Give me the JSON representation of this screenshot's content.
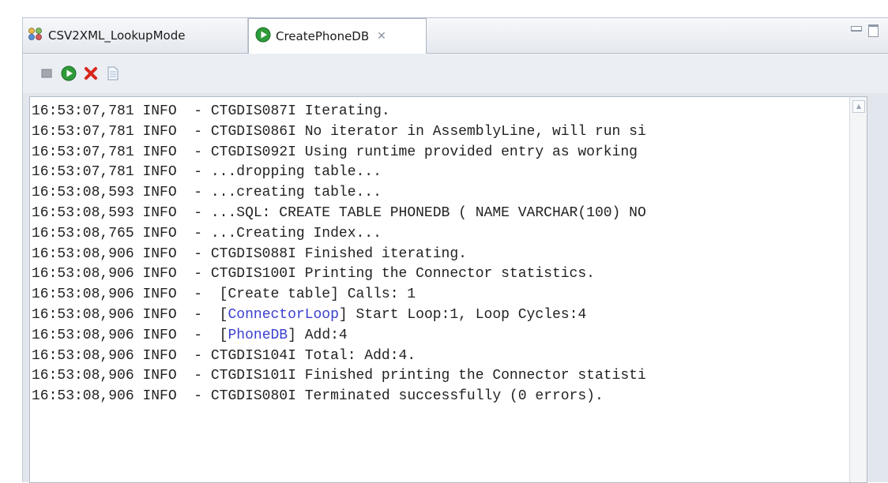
{
  "tabs": [
    {
      "label": "CSV2XML_LookupMode",
      "icon": "assembly-line-icon",
      "active": false
    },
    {
      "label": "CreatePhoneDB",
      "icon": "run-icon",
      "active": true,
      "close_glyph": "✕"
    }
  ],
  "toolbar": {
    "buttons": [
      "stop-icon",
      "run-icon",
      "clear-icon",
      "log-icon"
    ]
  },
  "console": {
    "lines": [
      {
        "time": "16:53:07,781",
        "level": "INFO",
        "pre": "- ",
        "link": "",
        "rest": "CTGDIS087I Iterating."
      },
      {
        "time": "16:53:07,781",
        "level": "INFO",
        "pre": "- ",
        "link": "",
        "rest": "CTGDIS086I No iterator in AssemblyLine, will run si"
      },
      {
        "time": "16:53:07,781",
        "level": "INFO",
        "pre": "- ",
        "link": "",
        "rest": "CTGDIS092I Using runtime provided entry as working "
      },
      {
        "time": "16:53:07,781",
        "level": "INFO",
        "pre": "- ",
        "link": "",
        "rest": "...dropping table..."
      },
      {
        "time": "16:53:08,593",
        "level": "INFO",
        "pre": "- ",
        "link": "",
        "rest": "...creating table..."
      },
      {
        "time": "16:53:08,593",
        "level": "INFO",
        "pre": "- ",
        "link": "",
        "rest": "...SQL: CREATE TABLE PHONEDB ( NAME VARCHAR(100) NO"
      },
      {
        "time": "16:53:08,765",
        "level": "INFO",
        "pre": "- ",
        "link": "",
        "rest": "...Creating Index..."
      },
      {
        "time": "16:53:08,906",
        "level": "INFO",
        "pre": "- ",
        "link": "",
        "rest": "CTGDIS088I Finished iterating."
      },
      {
        "time": "16:53:08,906",
        "level": "INFO",
        "pre": "- ",
        "link": "",
        "rest": "CTGDIS100I Printing the Connector statistics."
      },
      {
        "time": "16:53:08,906",
        "level": "INFO",
        "pre": "-  ",
        "link": "",
        "rest": "[Create table] Calls: 1"
      },
      {
        "time": "16:53:08,906",
        "level": "INFO",
        "pre": "-  [",
        "link": "ConnectorLoop",
        "rest": "] Start Loop:1, Loop Cycles:4"
      },
      {
        "time": "16:53:08,906",
        "level": "INFO",
        "pre": "-  [",
        "link": "PhoneDB",
        "rest": "] Add:4"
      },
      {
        "time": "16:53:08,906",
        "level": "INFO",
        "pre": "- ",
        "link": "",
        "rest": "CTGDIS104I Total: Add:4."
      },
      {
        "time": "16:53:08,906",
        "level": "INFO",
        "pre": "- ",
        "link": "",
        "rest": "CTGDIS101I Finished printing the Connector statisti"
      },
      {
        "time": "16:53:08,906",
        "level": "INFO",
        "pre": "- ",
        "link": "",
        "rest": "CTGDIS080I Terminated successfully (0 errors)."
      }
    ]
  },
  "colors": {
    "link": "#3a3fd0",
    "stop": "#9aa0a8",
    "run": "#2e9b3a",
    "clear": "#d9261c"
  }
}
